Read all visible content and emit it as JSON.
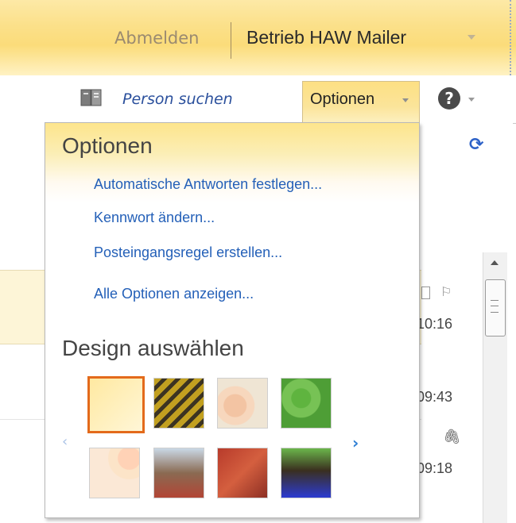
{
  "header": {
    "signout_label": "Abmelden",
    "account_name": "Betrieb HAW Mailer"
  },
  "toolbar": {
    "find_person_label": "Person suchen",
    "options_label": "Optionen",
    "help_label": "?"
  },
  "options_menu": {
    "title": "Optionen",
    "links": [
      "Automatische Antworten festlegen...",
      "Kennwort ändern...",
      "Posteingangsregel erstellen...",
      "Alle Optionen anzeigen..."
    ],
    "design_title": "Design auswählen",
    "themes": [
      {
        "name": "theme-default",
        "selected": true
      },
      {
        "name": "theme-2",
        "selected": false
      },
      {
        "name": "theme-3",
        "selected": false
      },
      {
        "name": "theme-4",
        "selected": false
      },
      {
        "name": "theme-5",
        "selected": false
      },
      {
        "name": "theme-6",
        "selected": false
      },
      {
        "name": "theme-7",
        "selected": false
      },
      {
        "name": "theme-8",
        "selected": false
      }
    ],
    "prev_label": "‹",
    "next_label": "›"
  },
  "mail_list": {
    "times": [
      "10:16",
      "09:43",
      "09:18"
    ]
  },
  "colors": {
    "accent": "#fbdc7a",
    "link": "#2460b8",
    "selected_theme_border": "#e36a1b"
  },
  "icons": {
    "address_book": "address-book-icon",
    "help": "help-icon",
    "refresh": "refresh-icon",
    "attachment": "paperclip-icon",
    "flag": "flag-icon"
  }
}
